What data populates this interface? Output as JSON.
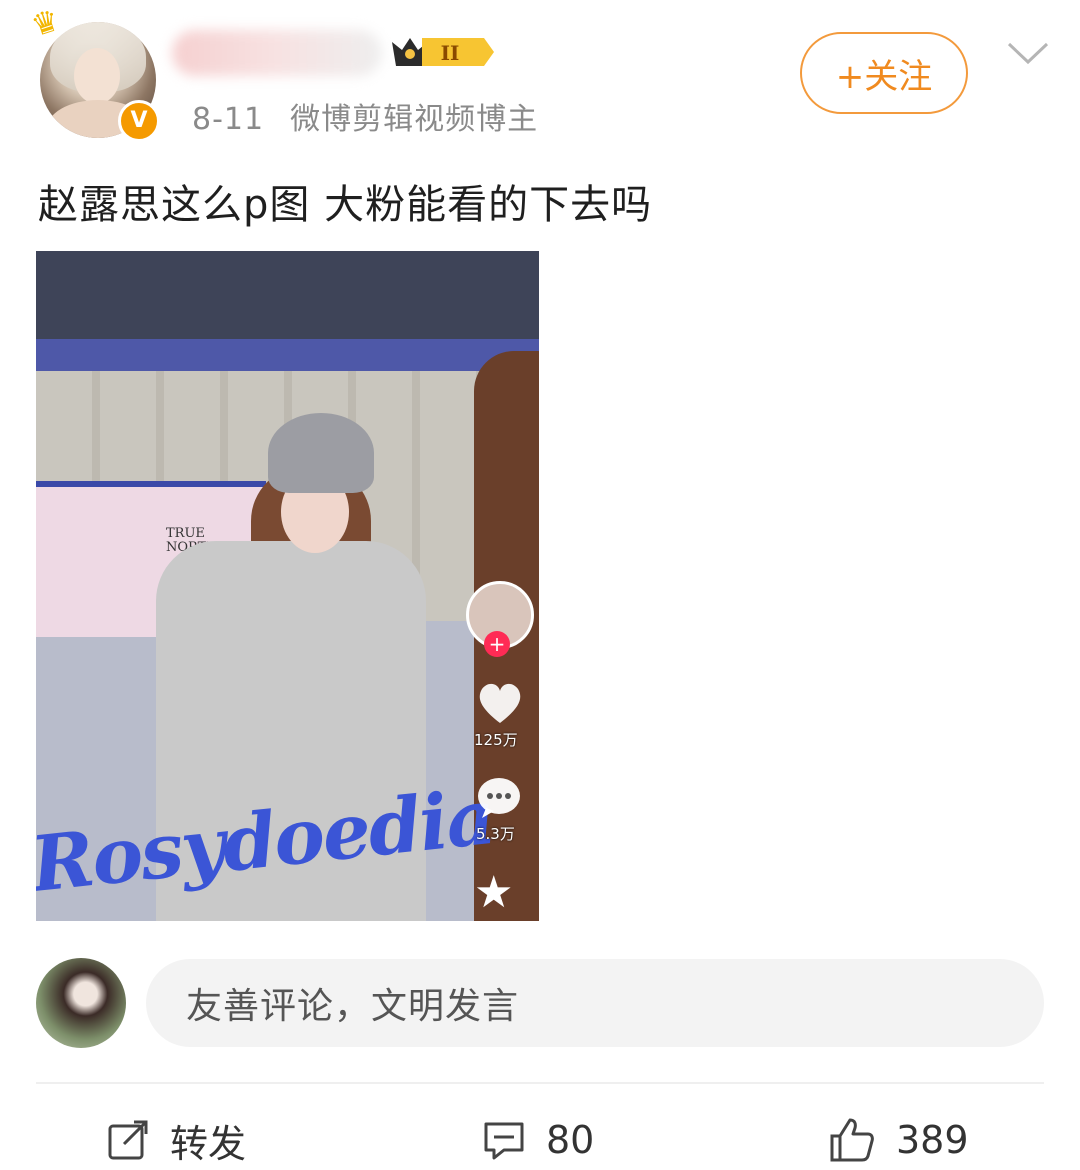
{
  "author": {
    "post_date": "8-11",
    "bio": "微博剪辑视频博主",
    "level_badge": "II",
    "verified_badge": "V"
  },
  "follow_button": {
    "label": "+关注"
  },
  "post": {
    "text": "赵露思这么p图 大粉能看的下去吗"
  },
  "embedded_image": {
    "stage_text": "Rosydoedia",
    "booth_sign": "TRUE NORTH",
    "likes": "125万",
    "comments": "5.3万"
  },
  "comment_input": {
    "placeholder": "友善评论，文明发言"
  },
  "actions": {
    "repost_label": "转发",
    "comment_count": "80",
    "like_count": "389"
  },
  "icons": {
    "crown": "crown-icon",
    "more": "chevron-down-icon",
    "repost": "share-icon",
    "comment": "comment-icon",
    "like": "thumbs-up-icon"
  },
  "colors": {
    "accent_orange": "#f08a1f",
    "verified_orange": "#f59a00",
    "text_gray": "#8a8a8a"
  }
}
